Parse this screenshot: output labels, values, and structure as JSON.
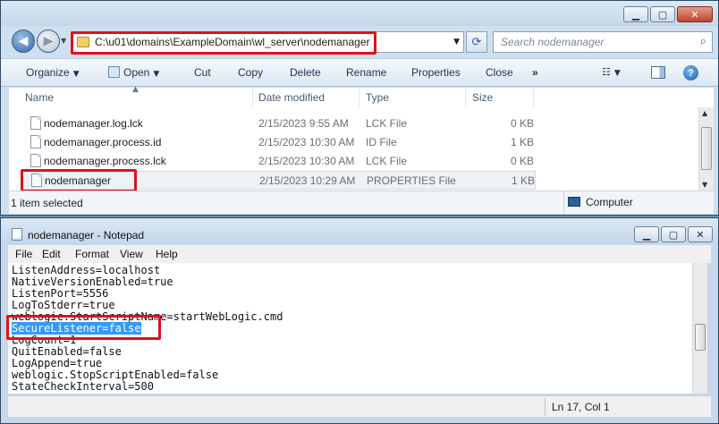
{
  "explorer": {
    "address": "C:\\u01\\domains\\ExampleDomain\\wl_server\\nodemanager",
    "search_placeholder": "Search nodemanager",
    "toolbar": {
      "organize": "Organize",
      "open": "Open",
      "cut": "Cut",
      "copy": "Copy",
      "delete": "Delete",
      "rename": "Rename",
      "properties": "Properties",
      "close": "Close",
      "more": "»"
    },
    "columns": {
      "name": "Name",
      "date": "Date modified",
      "type": "Type",
      "size": "Size"
    },
    "files": [
      {
        "name": "nodemanager.log.lck",
        "date": "2/15/2023 9:55 AM",
        "type": "LCK File",
        "size": "0 KB"
      },
      {
        "name": "nodemanager.process.id",
        "date": "2/15/2023 10:30 AM",
        "type": "ID File",
        "size": "1 KB"
      },
      {
        "name": "nodemanager.process.lck",
        "date": "2/15/2023 10:30 AM",
        "type": "LCK File",
        "size": "0 KB"
      },
      {
        "name": "nodemanager",
        "date": "2/15/2023 10:29 AM",
        "type": "PROPERTIES File",
        "size": "1 KB"
      }
    ],
    "status_selected": "1 item selected",
    "status_location": "Computer",
    "accent_red": "#e0101a"
  },
  "notepad": {
    "title": "nodemanager - Notepad",
    "menu": [
      "File",
      "Edit",
      "Format",
      "View",
      "Help"
    ],
    "lines": [
      "ListenAddress=localhost",
      "NativeVersionEnabled=true",
      "ListenPort=5556",
      "LogToStderr=true",
      "weblogic.StartScriptName=startWebLogic.cmd",
      "SecureListener=false",
      "LogCount=1",
      "QuitEnabled=false",
      "LogAppend=true",
      "weblogic.StopScriptEnabled=false",
      "StateCheckInterval=500"
    ],
    "cursor_position": "Ln 17, Col 1",
    "selection_color": "#3399ff"
  }
}
